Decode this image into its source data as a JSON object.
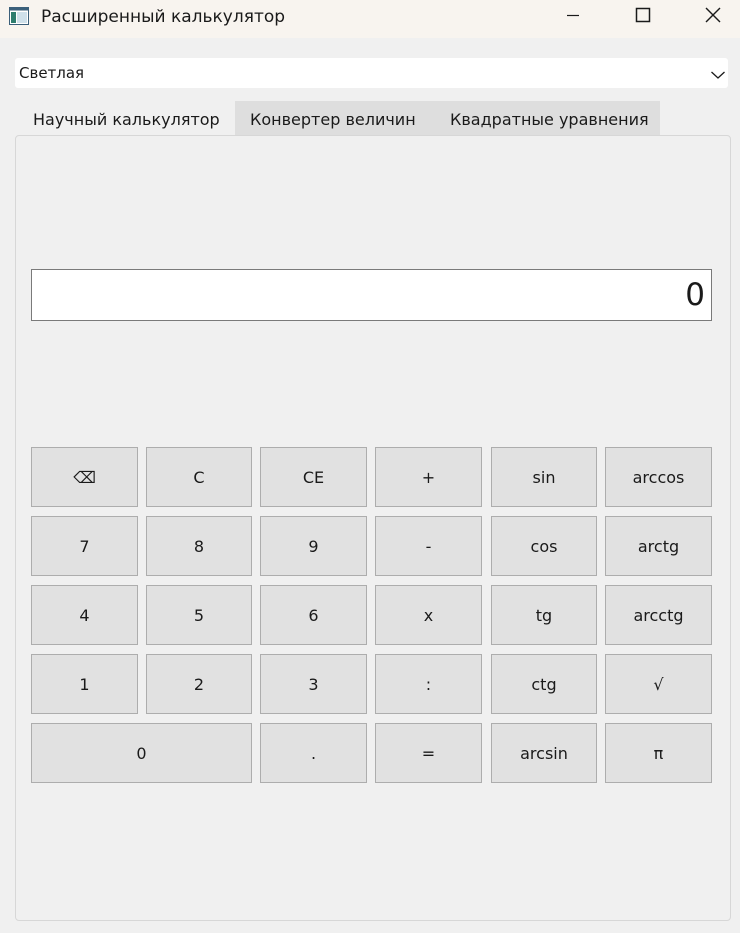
{
  "window": {
    "title": "Расширенный калькулятор"
  },
  "theme_select": {
    "value": "Светлая"
  },
  "tabs": [
    {
      "label": "Научный калькулятор",
      "active": true
    },
    {
      "label": "Конвертер величин",
      "active": false
    },
    {
      "label": "Квадратные уравнения",
      "active": false
    }
  ],
  "display": {
    "value": "0"
  },
  "keys": {
    "backspace": "⌫",
    "clear": "C",
    "clear_entry": "CE",
    "plus": "+",
    "sin": "sin",
    "arccos": "arccos",
    "seven": "7",
    "eight": "8",
    "nine": "9",
    "minus": "-",
    "cos": "cos",
    "arctg": "arctg",
    "four": "4",
    "five": "5",
    "six": "6",
    "multiply": "x",
    "tg": "tg",
    "arcctg": "arcctg",
    "one": "1",
    "two": "2",
    "three": "3",
    "divide": ":",
    "ctg": "ctg",
    "sqrt": "√",
    "zero": "0",
    "decimal": ".",
    "equals": "=",
    "arcsin": "arcsin",
    "pi": "π"
  },
  "icons": {
    "app": "app-window-icon",
    "minimize": "minimize-icon",
    "maximize": "maximize-icon",
    "close": "close-icon",
    "dropdown": "chevron-down-icon"
  },
  "colors": {
    "titlebar": "#f8f4ef",
    "window_bg": "#f0f0f0",
    "key_bg": "#e1e1e1",
    "key_border": "#adadad",
    "tab_strip": "#dedede"
  }
}
